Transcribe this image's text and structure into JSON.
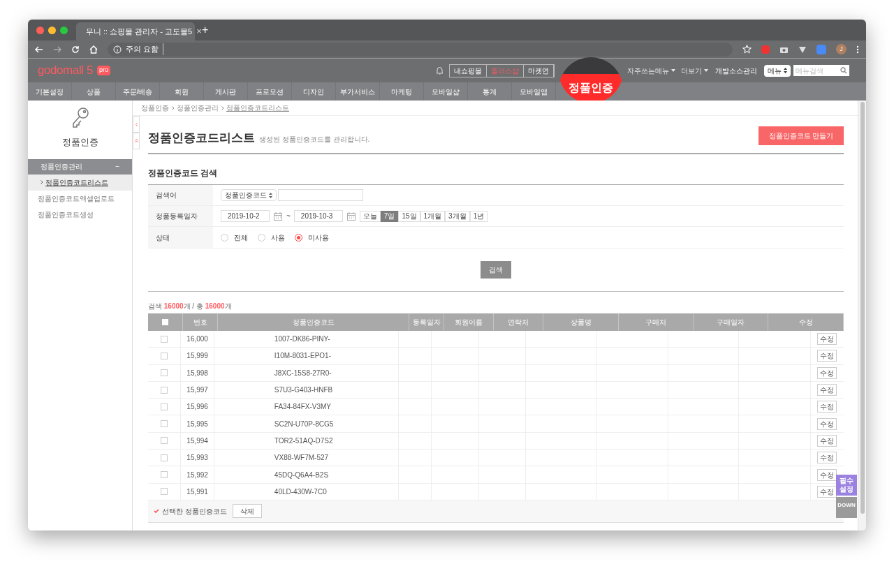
{
  "browser": {
    "tab_title": "무니 :: 쇼핑몰 관리자 - 고도몰5",
    "tab_close": "×",
    "new_tab": "+",
    "address": "주의 요함",
    "profile_initial": "J"
  },
  "header": {
    "logo": "godomall 5",
    "logo_badge": "pro",
    "shop_links": [
      {
        "label": "내쇼핑몰",
        "highlight": false
      },
      {
        "label": "플러스샵",
        "highlight": true
      },
      {
        "label": "마켓연",
        "highlight": false
      }
    ],
    "menus": [
      "자주쓰는메뉴",
      "더보기"
    ],
    "dev_link": "개발소스관리",
    "menu_select": "메뉴",
    "menu_search_placeholder": "메뉴검색"
  },
  "callout": "정품인증",
  "nav": [
    "기본설정",
    "상품",
    "주문/배송",
    "회원",
    "게시판",
    "프로모션",
    "디자인",
    "부가서비스",
    "마케팅",
    "모바일샵",
    "통계",
    "모바일앱"
  ],
  "sidebar": {
    "title": "정품인증",
    "group": {
      "label": "정품인증관리",
      "toggle": "−",
      "expanded": true
    },
    "items": [
      {
        "label": "정품인증코드리스트",
        "selected": true
      },
      {
        "label": "정품인증코드엑셀업로드",
        "selected": false
      },
      {
        "label": "정품인증코드생성",
        "selected": false
      }
    ]
  },
  "breadcrumb": [
    "정품인증",
    "정품인증관리",
    "정품인증코드리스트"
  ],
  "page": {
    "title": "정품인증코드리스트",
    "subtitle": "생성된 정품인증코드를 관리합니다.",
    "create_button": "정품인증코드 만들기"
  },
  "search": {
    "title": "정품인증코드 검색",
    "keyword": {
      "label": "검색어",
      "select": "정품인증코드"
    },
    "date": {
      "label": "정품등록일자",
      "from": "2019-10-2",
      "to": "2019-10-3",
      "tilde": "~",
      "periods": [
        {
          "label": "오늘",
          "selected": false
        },
        {
          "label": "7일",
          "selected": true
        },
        {
          "label": "15일",
          "selected": false
        },
        {
          "label": "1개월",
          "selected": false
        },
        {
          "label": "3개월",
          "selected": false
        },
        {
          "label": "1년",
          "selected": false
        }
      ]
    },
    "status": {
      "label": "상태",
      "options": [
        {
          "label": "전체",
          "selected": false
        },
        {
          "label": "사용",
          "selected": false
        },
        {
          "label": "미사용",
          "selected": true
        }
      ]
    },
    "button": "검색"
  },
  "result_count": {
    "prefix": "검색",
    "found": "16000",
    "middle": "개 / 총",
    "total": "16000",
    "suffix": "개"
  },
  "table": {
    "columns": [
      "번호",
      "정품인증코드",
      "등록일자",
      "회원이름",
      "연락처",
      "상품명",
      "구매처",
      "구매일자",
      "수정"
    ],
    "select_all_checked": false,
    "rows": [
      {
        "checked": false,
        "number": "16,000",
        "code": "1007-DK86-PINY-",
        "edit": "수정"
      },
      {
        "checked": false,
        "number": "15,999",
        "code": "I10M-8031-EPO1-",
        "edit": "수정"
      },
      {
        "checked": false,
        "number": "15,998",
        "code": "J8XC-15S8-27R0-",
        "edit": "수정"
      },
      {
        "checked": false,
        "number": "15,997",
        "code": "S7U3-G403-HNFB",
        "edit": "수정"
      },
      {
        "checked": false,
        "number": "15,996",
        "code": "FA34-84FX-V3MY",
        "edit": "수정"
      },
      {
        "checked": false,
        "number": "15,995",
        "code": "SC2N-U70P-8CG5",
        "edit": "수정"
      },
      {
        "checked": false,
        "number": "15,994",
        "code": "TOR2-51AQ-D7S2",
        "edit": "수정"
      },
      {
        "checked": false,
        "number": "15,993",
        "code": "VX88-WF7M-527",
        "edit": "수정"
      },
      {
        "checked": false,
        "number": "15,992",
        "code": "45DQ-Q6A4-B2S",
        "edit": "수정"
      },
      {
        "checked": false,
        "number": "15,991",
        "code": "40LD-430W-7C0",
        "edit": "수정"
      }
    ],
    "footer_label": "선택한 정품인증코드",
    "delete_button": "삭제"
  },
  "floating": {
    "settings": "필수\n설정",
    "down": "DOWN"
  }
}
